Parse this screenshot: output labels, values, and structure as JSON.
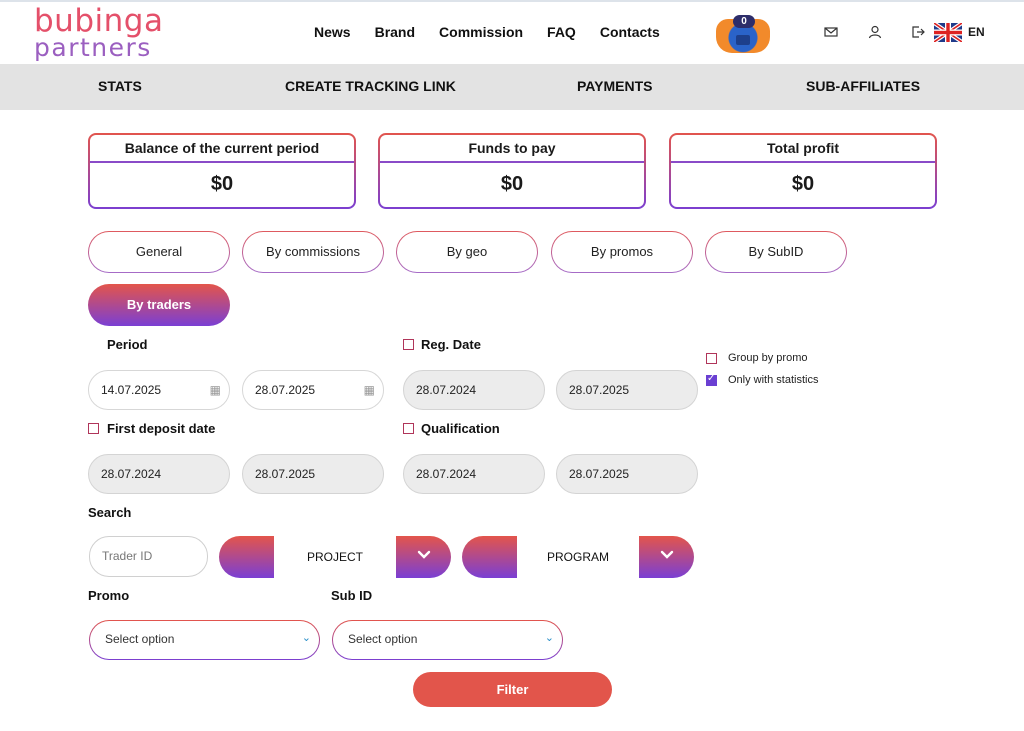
{
  "brand": {
    "line1": "bubinga",
    "line2": "partners"
  },
  "nav": [
    "News",
    "Brand",
    "Commission",
    "FAQ",
    "Contacts"
  ],
  "header": {
    "badge_count": "0",
    "language": "EN"
  },
  "subnav": [
    "STATS",
    "CREATE TRACKING LINK",
    "PAYMENTS",
    "SUB-AFFILIATES"
  ],
  "cards": [
    {
      "title": "Balance of the current period",
      "value": "$0"
    },
    {
      "title": "Funds to pay",
      "value": "$0"
    },
    {
      "title": "Total profit",
      "value": "$0"
    }
  ],
  "tabs": [
    "General",
    "By commissions",
    "By geo",
    "By promos",
    "By SubID",
    "By traders"
  ],
  "filters": {
    "period_label": "Period",
    "period_from": "14.07.2025",
    "period_to": "28.07.2025",
    "reg_date_label": "Reg. Date",
    "reg_from": "28.07.2024",
    "reg_to": "28.07.2025",
    "first_deposit_label": "First deposit date",
    "fd_from": "28.07.2024",
    "fd_to": "28.07.2025",
    "qualification_label": "Qualification",
    "q_from": "28.07.2024",
    "q_to": "28.07.2025",
    "group_by_promo": "Group by promo",
    "only_with_stats": "Only with statistics",
    "search_label": "Search",
    "trader_placeholder": "Trader ID",
    "project": "PROJECT",
    "program": "PROGRAM",
    "promo_label": "Promo",
    "subid_label": "Sub ID",
    "promo_select": "Select option",
    "subid_select": "Select option",
    "filter_button": "Filter"
  }
}
